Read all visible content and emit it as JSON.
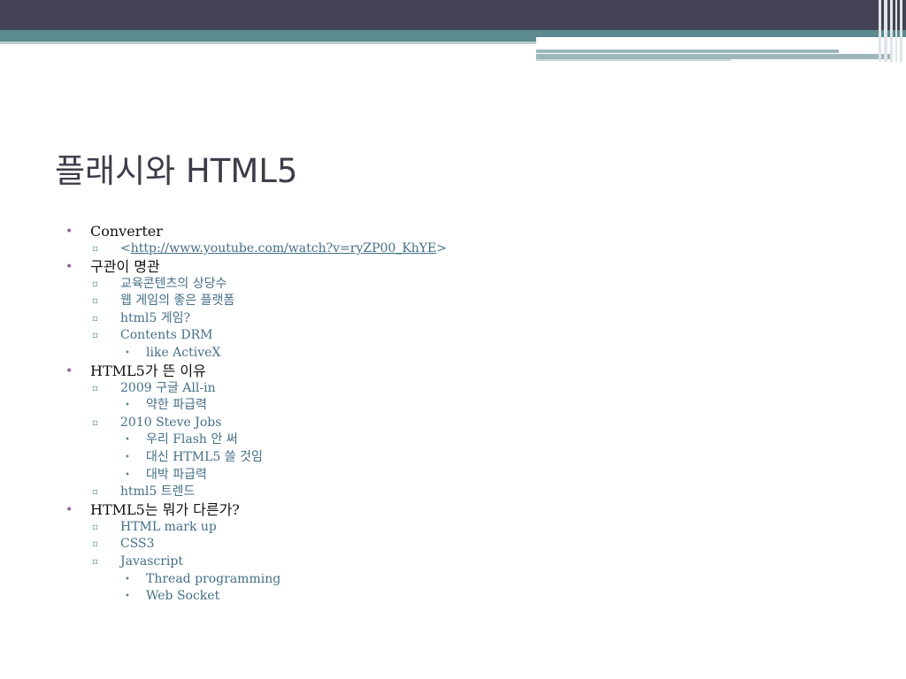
{
  "title": "플래시와 HTML5",
  "bullets": {
    "level1": "•",
    "level2": "▫",
    "level3": "•"
  },
  "items": [
    {
      "text": "Converter"
    },
    {
      "text_open": "<",
      "link": "http://www.youtube.com/watch?v=ryZP00_KhYE",
      "text_close": ">"
    },
    {
      "text": "구관이 명관"
    },
    {
      "text": "교육콘텐츠의 상당수"
    },
    {
      "text": "웹 게임의 좋은 플랫폼"
    },
    {
      "text": "html5 게임?"
    },
    {
      "text": "Contents DRM"
    },
    {
      "text": "like ActiveX"
    },
    {
      "text": "HTML5가 뜬 이유"
    },
    {
      "text": "2009 구글 All-in"
    },
    {
      "text": "약한 파급력"
    },
    {
      "text": "2010 Steve Jobs"
    },
    {
      "text": "우리 Flash 안 써"
    },
    {
      "text": "대신 HTML5 쓸 것임"
    },
    {
      "text": "대박 파급력"
    },
    {
      "text": "html5 트렌드"
    },
    {
      "text": "HTML5는 뭐가 다른가?"
    },
    {
      "text": "HTML mark up"
    },
    {
      "text": "CSS3"
    },
    {
      "text": "Javascript"
    },
    {
      "text": "Thread programming"
    },
    {
      "text": "Web Socket"
    }
  ],
  "colors": {
    "header_dark": "#434355",
    "header_teal": "#5b8a90",
    "level1_bullet": "#a25ab0",
    "sub_text": "#446f86",
    "title_text": "#3d3d4a"
  }
}
